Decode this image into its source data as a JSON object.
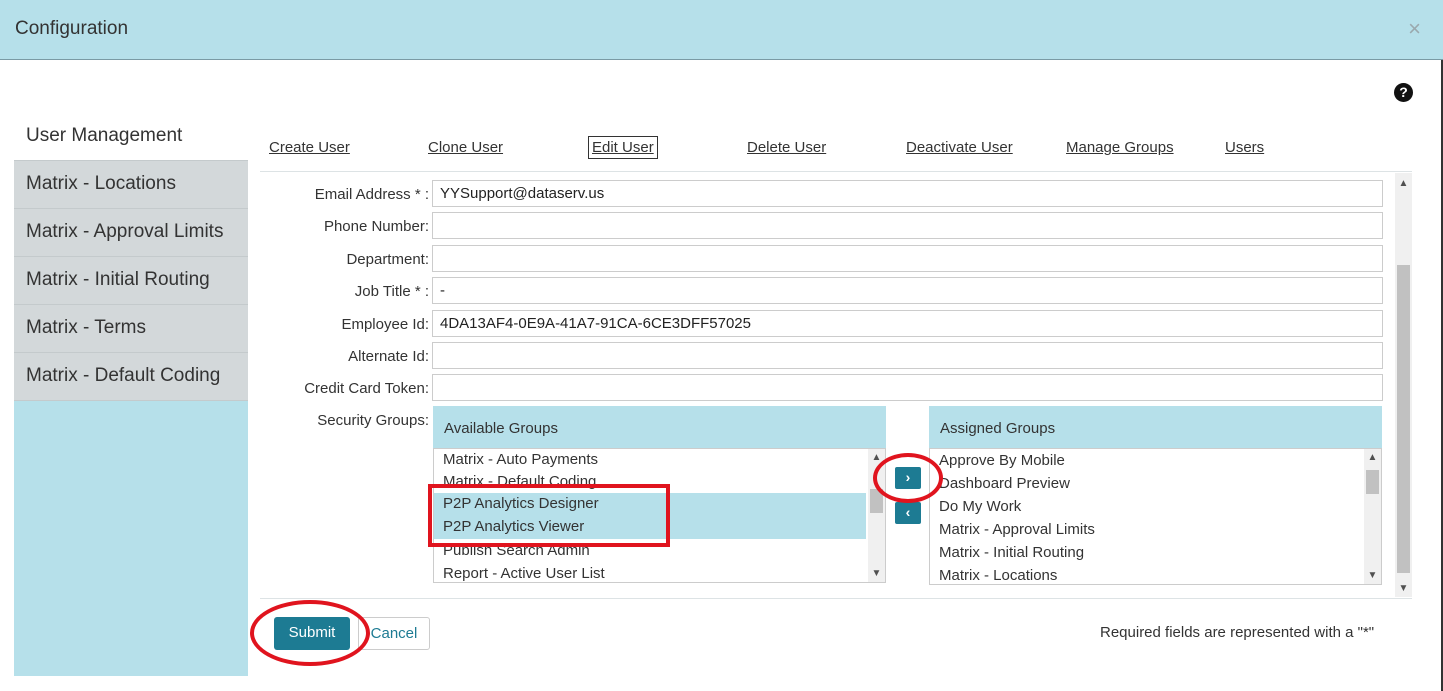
{
  "window": {
    "title": "Configuration",
    "close_label": "×",
    "help_label": "?"
  },
  "sidebar": {
    "items": [
      {
        "label": "User Management"
      },
      {
        "label": "Matrix - Locations"
      },
      {
        "label": "Matrix - Approval Limits"
      },
      {
        "label": "Matrix - Initial Routing"
      },
      {
        "label": "Matrix - Terms"
      },
      {
        "label": "Matrix - Default Coding"
      }
    ]
  },
  "tabs": [
    {
      "label": "Create User"
    },
    {
      "label": "Clone User"
    },
    {
      "label": "Edit User"
    },
    {
      "label": "Delete User"
    },
    {
      "label": "Deactivate User"
    },
    {
      "label": "Manage Groups"
    },
    {
      "label": "Users"
    }
  ],
  "form": {
    "email_label": "Email Address * :",
    "email_value": "YYSupport@dataserv.us",
    "phone_label": "Phone Number:",
    "phone_value": "",
    "department_label": "Department:",
    "department_value": "",
    "jobtitle_label": "Job Title * :",
    "jobtitle_value": "-",
    "employeeid_label": "Employee Id:",
    "employeeid_value": "4DA13AF4-0E9A-41A7-91CA-6CE3DFF57025",
    "alternateid_label": "Alternate Id:",
    "alternateid_value": "",
    "cctoken_label": "Credit Card Token:",
    "cctoken_value": "",
    "security_label": "Security Groups:"
  },
  "available_groups": {
    "header": "Available Groups",
    "items": [
      {
        "label": "Matrix - Auto Payments"
      },
      {
        "label": "Matrix - Default Coding"
      },
      {
        "label": "P2P Analytics Designer"
      },
      {
        "label": "P2P Analytics Viewer"
      },
      {
        "label": "Publish Search Admin"
      },
      {
        "label": "Report - Active User List"
      }
    ]
  },
  "assigned_groups": {
    "header": "Assigned Groups",
    "items": [
      {
        "label": "Approve By Mobile"
      },
      {
        "label": "Dashboard Preview"
      },
      {
        "label": "Do My Work"
      },
      {
        "label": "Matrix - Approval Limits"
      },
      {
        "label": "Matrix - Initial Routing"
      },
      {
        "label": "Matrix - Locations"
      }
    ]
  },
  "buttons": {
    "add_label": "›",
    "remove_label": "‹",
    "submit_label": "Submit",
    "cancel_label": "Cancel"
  },
  "footer": {
    "required_note": "Required fields are represented with a \"*\""
  },
  "colors": {
    "header_bg": "#b6e0ea",
    "accent": "#1d7b93",
    "annotation": "#e0141e"
  }
}
